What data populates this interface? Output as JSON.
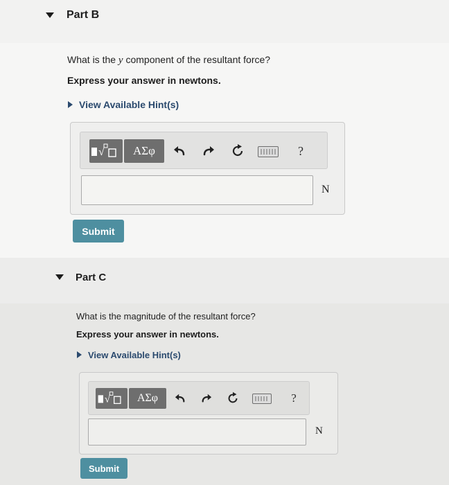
{
  "partB": {
    "title": "Part B",
    "question_prefix": "What is the ",
    "question_var": "y",
    "question_suffix": " component of the resultant force?",
    "instruction": "Express your answer in newtons.",
    "hint": "View Available Hint(s)",
    "toolbar": {
      "greek": "ΑΣφ",
      "help": "?"
    },
    "unit": "N",
    "submit": "Submit"
  },
  "partC": {
    "title": "Part C",
    "question": "What is the magnitude of the resultant force?",
    "instruction": "Express your answer in newtons.",
    "hint": "View Available Hint(s)",
    "toolbar": {
      "greek": "ΑΣφ",
      "help": "?"
    },
    "unit": "N",
    "submit": "Submit"
  }
}
